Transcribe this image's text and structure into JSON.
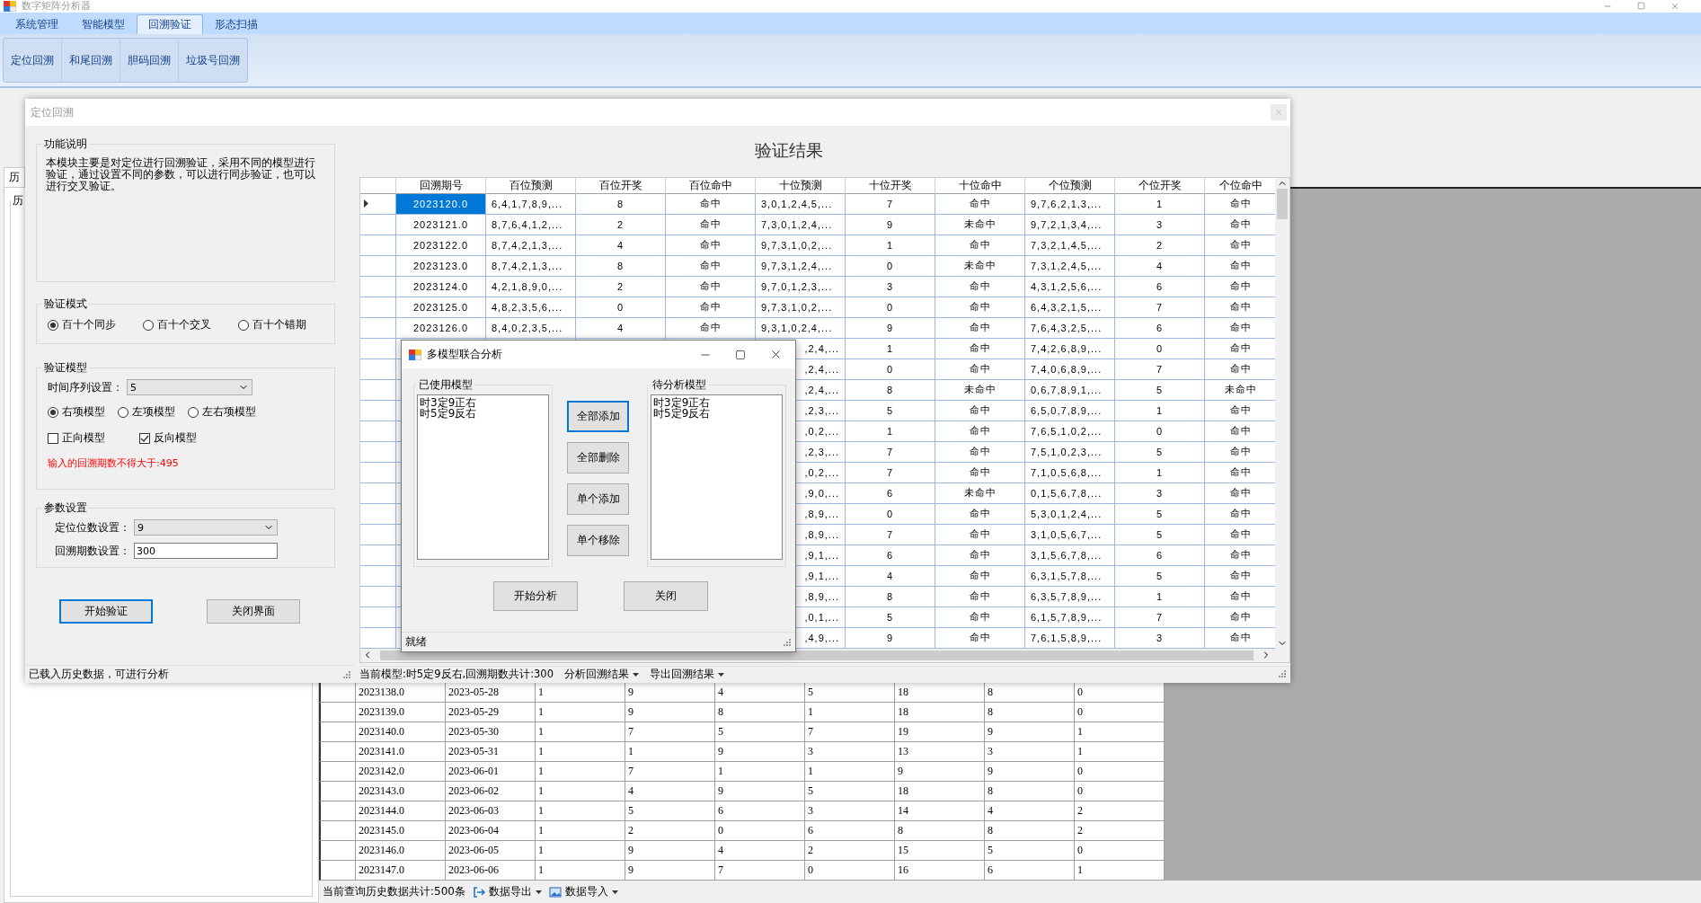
{
  "app": {
    "title": "数字矩阵分析器"
  },
  "ribbon": {
    "tabs": [
      {
        "label": "系统管理",
        "selected": false
      },
      {
        "label": "智能模型",
        "selected": false
      },
      {
        "label": "回溯验证",
        "selected": true
      },
      {
        "label": "形态扫描",
        "selected": false
      }
    ],
    "buttons": [
      "定位回溯",
      "和尾回溯",
      "胆码回溯",
      "垃圾号回溯"
    ]
  },
  "history": {
    "tab": "历",
    "group": "历",
    "rows": [
      [
        "2023138.0",
        "2023-05-28",
        "1",
        "9",
        "4",
        "5",
        "18",
        "8",
        "0"
      ],
      [
        "2023139.0",
        "2023-05-29",
        "1",
        "9",
        "8",
        "1",
        "18",
        "8",
        "0"
      ],
      [
        "2023140.0",
        "2023-05-30",
        "1",
        "7",
        "5",
        "7",
        "19",
        "9",
        "1"
      ],
      [
        "2023141.0",
        "2023-05-31",
        "1",
        "1",
        "9",
        "3",
        "13",
        "3",
        "1"
      ],
      [
        "2023142.0",
        "2023-06-01",
        "1",
        "7",
        "1",
        "1",
        "9",
        "9",
        "0"
      ],
      [
        "2023143.0",
        "2023-06-02",
        "1",
        "4",
        "9",
        "5",
        "18",
        "8",
        "0"
      ],
      [
        "2023144.0",
        "2023-06-03",
        "1",
        "5",
        "6",
        "3",
        "14",
        "4",
        "2"
      ],
      [
        "2023145.0",
        "2023-06-04",
        "1",
        "2",
        "0",
        "6",
        "8",
        "8",
        "2"
      ],
      [
        "2023146.0",
        "2023-06-05",
        "1",
        "9",
        "4",
        "2",
        "15",
        "5",
        "0"
      ],
      [
        "2023147.0",
        "2023-06-06",
        "1",
        "9",
        "7",
        "0",
        "16",
        "6",
        "1"
      ]
    ],
    "status": {
      "count": "当前查询历史数据共计:500条",
      "export": "数据导出",
      "import": "数据导入"
    }
  },
  "backtest": {
    "title": "定位回溯",
    "description": {
      "title": "功能说明",
      "text": "本模块主要是对定位进行回溯验证，采用不同的模型进行验证，通过设置不同的参数，可以进行同步验证，也可以进行交叉验证。"
    },
    "mode": {
      "title": "验证模式",
      "options": [
        {
          "label": "百十个同步",
          "selected": true
        },
        {
          "label": "百十个交叉",
          "selected": false
        },
        {
          "label": "百十个错期",
          "selected": false
        }
      ]
    },
    "model": {
      "title": "验证模型",
      "series_label": "时间序列设置：",
      "series_value": "5",
      "sides": [
        {
          "label": "右项模型",
          "selected": true
        },
        {
          "label": "左项模型",
          "selected": false
        },
        {
          "label": "左右项模型",
          "selected": false
        }
      ],
      "directions": [
        {
          "label": "正向模型",
          "checked": false
        },
        {
          "label": "反向模型",
          "checked": true
        }
      ],
      "warning": "输入的回溯期数不得大于:495"
    },
    "params": {
      "title": "参数设置",
      "digits_label": "定位位数设置：",
      "digits_value": "9",
      "periods_label": "回溯期数设置：",
      "periods_value": "300"
    },
    "buttons": [
      {
        "label": "开始验证",
        "focused": true
      },
      {
        "label": "关闭界面",
        "focused": false
      }
    ],
    "status": "已载入历史数据，可进行分析",
    "results": {
      "title": "验证结果",
      "columns": [
        "回溯期号",
        "百位预测",
        "百位开奖",
        "百位命中",
        "十位预测",
        "十位开奖",
        "十位命中",
        "个位预测",
        "个位开奖",
        "个位命中"
      ],
      "rows": [
        {
          "selected": true,
          "cells": [
            "2023120.0",
            "6,4,1,7,8,9,...",
            "8",
            "命中",
            "3,0,1,2,4,5,...",
            "7",
            "命中",
            "9,7,6,2,1,3,...",
            "1",
            "命中"
          ]
        },
        {
          "selected": false,
          "cells": [
            "2023121.0",
            "8,7,6,4,1,2,...",
            "2",
            "命中",
            "7,3,0,1,2,4,...",
            "9",
            "未命中",
            "9,7,2,1,3,4,...",
            "3",
            "命中"
          ]
        },
        {
          "selected": false,
          "cells": [
            "2023122.0",
            "8,7,4,2,1,3,...",
            "4",
            "命中",
            "9,7,3,1,0,2,...",
            "1",
            "命中",
            "7,3,2,1,4,5,...",
            "2",
            "命中"
          ]
        },
        {
          "selected": false,
          "cells": [
            "2023123.0",
            "8,7,4,2,1,3,...",
            "8",
            "命中",
            "9,7,3,1,2,4,...",
            "0",
            "未命中",
            "7,3,1,2,4,5,...",
            "4",
            "命中"
          ]
        },
        {
          "selected": false,
          "cells": [
            "2023124.0",
            "4,2,1,8,9,0,...",
            "2",
            "命中",
            "9,7,0,1,2,3,...",
            "3",
            "命中",
            "4,3,1,2,5,6,...",
            "6",
            "命中"
          ]
        },
        {
          "selected": false,
          "cells": [
            "2023125.0",
            "4,8,2,3,5,6,...",
            "0",
            "命中",
            "9,7,3,1,0,2,...",
            "0",
            "命中",
            "6,4,3,2,1,5,...",
            "7",
            "命中"
          ]
        },
        {
          "selected": false,
          "cells": [
            "2023126.0",
            "8,4,0,2,3,5,...",
            "4",
            "命中",
            "9,3,1,0,2,4,...",
            "9",
            "命中",
            "7,6,4,3,2,5,...",
            "6",
            "命中"
          ]
        },
        {
          "selected": false,
          "cells": [
            ",2,4,...",
            "1",
            "命中",
            "7,4,2,6,8,9,...",
            "0",
            "命中"
          ]
        },
        {
          "selected": false,
          "cells": [
            ",2,4,...",
            "0",
            "命中",
            "7,4,0,6,8,9,...",
            "7",
            "命中"
          ]
        },
        {
          "selected": false,
          "cells": [
            ",2,4,...",
            "8",
            "未命中",
            "0,6,7,8,9,1,...",
            "5",
            "未命中"
          ]
        },
        {
          "selected": false,
          "cells": [
            ",2,3,...",
            "5",
            "命中",
            "6,5,0,7,8,9,...",
            "1",
            "命中"
          ]
        },
        {
          "selected": false,
          "cells": [
            ",0,2,...",
            "1",
            "命中",
            "7,6,5,1,0,2,...",
            "0",
            "命中"
          ]
        },
        {
          "selected": false,
          "cells": [
            ",2,3,...",
            "7",
            "命中",
            "7,5,1,0,2,3,...",
            "5",
            "命中"
          ]
        },
        {
          "selected": false,
          "cells": [
            ",0,2,...",
            "7",
            "命中",
            "7,1,0,5,6,8,...",
            "1",
            "命中"
          ]
        },
        {
          "selected": false,
          "cells": [
            ",9,0,...",
            "6",
            "未命中",
            "0,1,5,6,7,8,...",
            "3",
            "命中"
          ]
        },
        {
          "selected": false,
          "cells": [
            ",8,9,...",
            "0",
            "命中",
            "5,3,0,1,2,4,...",
            "5",
            "命中"
          ]
        },
        {
          "selected": false,
          "cells": [
            ",8,9,...",
            "7",
            "命中",
            "3,1,0,5,6,7,...",
            "5",
            "命中"
          ]
        },
        {
          "selected": false,
          "cells": [
            ",9,1,...",
            "6",
            "命中",
            "3,1,5,6,7,8,...",
            "6",
            "命中"
          ]
        },
        {
          "selected": false,
          "cells": [
            ",9,1,...",
            "4",
            "命中",
            "6,3,1,5,7,8,...",
            "5",
            "命中"
          ]
        },
        {
          "selected": false,
          "cells": [
            ",8,9,...",
            "8",
            "命中",
            "6,3,5,7,8,9,...",
            "1",
            "命中"
          ]
        },
        {
          "selected": false,
          "cells": [
            ",0,1,...",
            "5",
            "命中",
            "6,1,5,7,8,9,...",
            "7",
            "命中"
          ]
        },
        {
          "selected": false,
          "cells": [
            ",4,9,...",
            "9",
            "命中",
            "7,6,1,5,8,9,...",
            "3",
            "命中"
          ]
        }
      ],
      "footer": {
        "model": "当前模型:时5定9反右,回溯期数共计:300",
        "menus": [
          "分析回溯结果",
          "导出回溯结果"
        ]
      }
    }
  },
  "dialog": {
    "title": "多模型联合分析",
    "used": {
      "title": "已使用模型",
      "items": [
        "时3定9正右",
        "时5定9反右"
      ]
    },
    "pending": {
      "title": "待分析模型",
      "items": [
        "时3定9正右",
        "时5定9反右"
      ]
    },
    "actions": [
      {
        "label": "全部添加",
        "focused": true
      },
      {
        "label": "全部删除",
        "focused": false
      },
      {
        "label": "单个添加",
        "focused": false
      },
      {
        "label": "单个移除",
        "focused": false
      }
    ],
    "buttons": [
      "开始分析",
      "关闭"
    ],
    "status": "就绪"
  }
}
